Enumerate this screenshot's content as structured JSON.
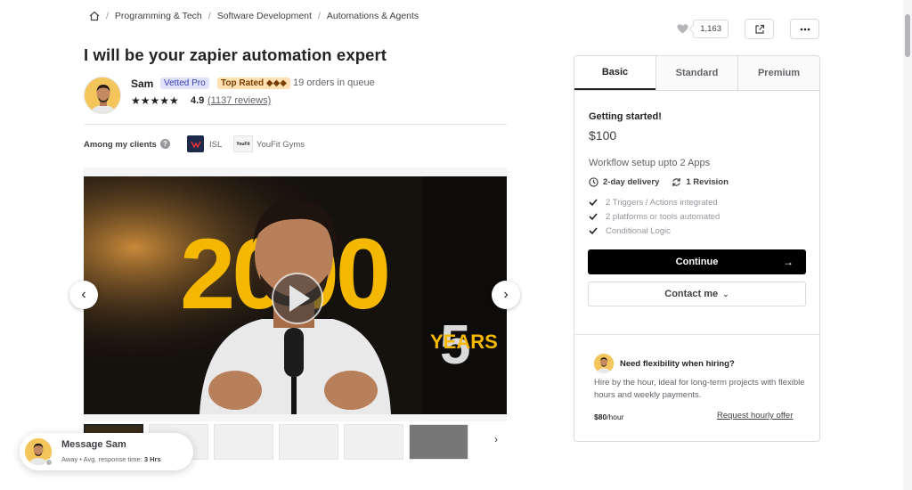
{
  "breadcrumb": {
    "items": [
      "Programming & Tech",
      "Software Development",
      "Automations & Agents"
    ]
  },
  "actions": {
    "like_count": "1,163"
  },
  "gig": {
    "title": "I will be your zapier automation expert"
  },
  "seller": {
    "name": "Sam",
    "badge_vetted": "Vetted Pro",
    "badge_top_rated": "Top Rated ◆◆◆",
    "orders_in_queue": "19 orders in queue",
    "rating": "4.9",
    "reviews": "(1137 reviews)",
    "stars": "★★★★★"
  },
  "clients": {
    "label": "Among my clients",
    "items": [
      {
        "name": "ISL"
      },
      {
        "name": "YouFit Gyms",
        "logo_text": "YouFit"
      }
    ]
  },
  "video": {
    "overlay_number": "2000",
    "overlay_years_number": "5",
    "overlay_years": "YEARS"
  },
  "message": {
    "title": "Message Sam",
    "status": "Away",
    "response_label": "Avg. response time:",
    "response_time": "3 Hrs"
  },
  "package": {
    "tabs": [
      "Basic",
      "Standard",
      "Premium"
    ],
    "active_tab": "Basic",
    "name": "Getting started!",
    "price": "$100",
    "description": "Workflow setup upto 2 Apps",
    "delivery": "2-day delivery",
    "revisions": "1 Revision",
    "features": [
      "2 Triggers / Actions integrated",
      "2 platforms or tools automated",
      "Conditional Logic"
    ],
    "continue_label": "Continue",
    "contact_label": "Contact me"
  },
  "hourly": {
    "title": "Need flexibility when hiring?",
    "description": "Hire by the hour, ideal for long-term projects with flexible hours and weekly payments.",
    "rate": "$80",
    "rate_unit": "/hour",
    "link": "Request hourly offer"
  },
  "colors": {
    "vetted_bg": "#dfe2fb",
    "top_rated_bg": "#ffe0b2",
    "video_overlay": "#f5b800",
    "continue_bg": "#000000"
  }
}
